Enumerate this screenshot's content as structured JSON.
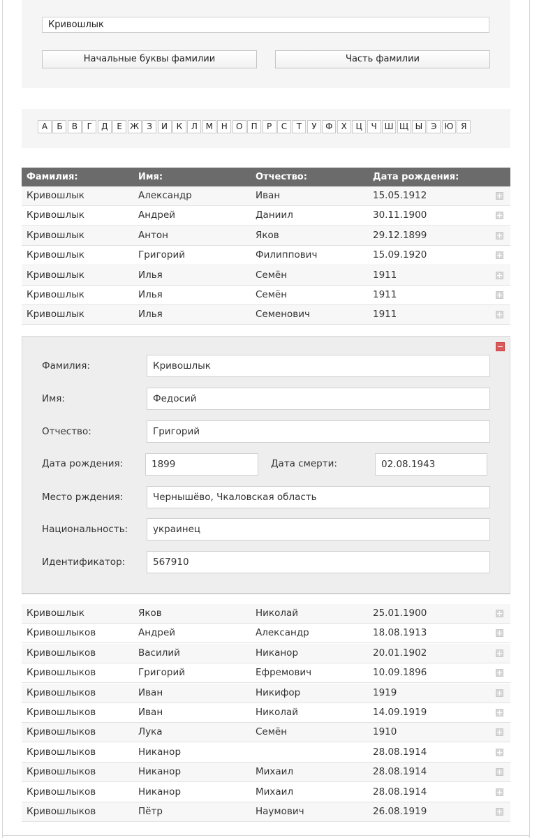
{
  "search": {
    "value": "Кривошлык",
    "btn_initials": "Начальные буквы фамилии",
    "btn_part": "Часть фамилии"
  },
  "alphabet": [
    "А",
    "Б",
    "В",
    "Г",
    "Д",
    "Е",
    "Ж",
    "З",
    "И",
    "К",
    "Л",
    "М",
    "Н",
    "О",
    "П",
    "Р",
    "С",
    "Т",
    "У",
    "Ф",
    "Х",
    "Ц",
    "Ч",
    "Ш",
    "Щ",
    "Ы",
    "Э",
    "Ю",
    "Я"
  ],
  "table": {
    "headers": {
      "surname": "Фамилия:",
      "name": "Имя:",
      "patronymic": "Отчество:",
      "birth": "Дата рождения:"
    },
    "rows_top": [
      [
        "Кривошлык",
        "Александр",
        "Иван",
        "15.05.1912"
      ],
      [
        "Кривошлык",
        "Андрей",
        "Даниил",
        "30.11.1900"
      ],
      [
        "Кривошлык",
        "Антон",
        "Яков",
        "29.12.1899"
      ],
      [
        "Кривошлык",
        "Григорий",
        "Филиппович",
        "15.09.1920"
      ],
      [
        "Кривошлык",
        "Илья",
        "Семён",
        "1911"
      ],
      [
        "Кривошлык",
        "Илья",
        "Семён",
        "1911"
      ],
      [
        "Кривошлык",
        "Илья",
        "Семенович",
        "1911"
      ]
    ],
    "rows_bottom": [
      [
        "Кривошлык",
        "Яков",
        "Николай",
        "25.01.1900"
      ],
      [
        "Кривошлыков",
        "Андрей",
        "Александр",
        "18.08.1913"
      ],
      [
        "Кривошлыков",
        "Василий",
        "Никанор",
        "20.01.1902"
      ],
      [
        "Кривошлыков",
        "Григорий",
        "Ефремович",
        "10.09.1896"
      ],
      [
        "Кривошлыков",
        "Иван",
        "Никифор",
        "1919"
      ],
      [
        "Кривошлыков",
        "Иван",
        "Николай",
        "14.09.1919"
      ],
      [
        "Кривошлыков",
        "Лука",
        "Семён",
        "1910"
      ],
      [
        "Кривошлыков",
        "Никанор",
        "",
        "28.08.1914"
      ],
      [
        "Кривошлыков",
        "Никанор",
        "Михаил",
        "28.08.1914"
      ],
      [
        "Кривошлыков",
        "Никанор",
        "Михаил",
        "28.08.1914"
      ],
      [
        "Кривошлыков",
        "Пётр",
        "Наумович",
        "26.08.1919"
      ]
    ]
  },
  "detail": {
    "labels": {
      "surname": "Фамилия:",
      "name": "Имя:",
      "patronymic": "Отчество:",
      "birth": "Дата рождения:",
      "death": "Дата смерти:",
      "birthplace": "Место рждения:",
      "nationality": "Национальность:",
      "id": "Идентификатор:"
    },
    "values": {
      "surname": "Кривошлык",
      "name": "Федосий",
      "patronymic": "Григорий",
      "birth": "1899",
      "death": "02.08.1943",
      "birthplace": "Чернышёво, Чкаловская область",
      "nationality": "украинец",
      "id": "567910"
    }
  },
  "icons": {
    "expand": "plus-square-icon",
    "collapse": "minus-square-icon"
  },
  "colors": {
    "header_bg": "#6b6b6b",
    "collapse_icon": "#d85a5a"
  }
}
